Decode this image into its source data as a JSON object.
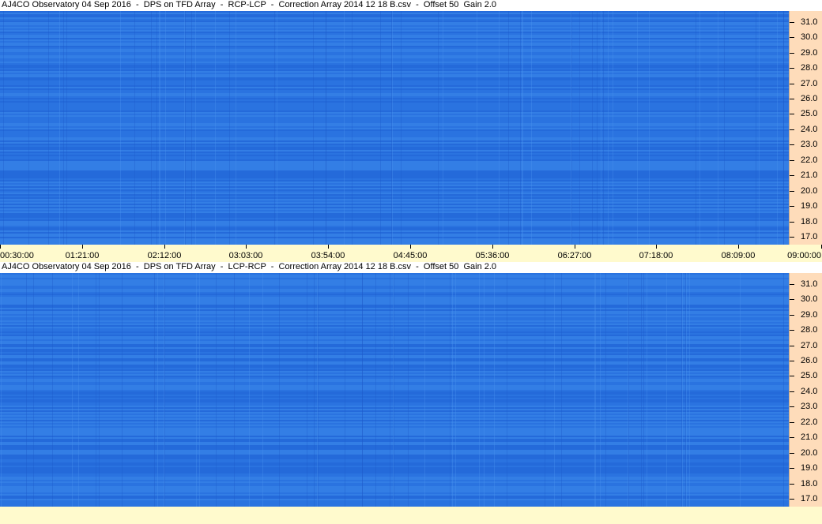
{
  "panels": [
    {
      "title": "AJ4CO Observatory 04 Sep 2016  -  DPS on TFD Array  -  RCP-LCP  -  Correction Array 2014 12 18 B.csv  -  Offset 50  Gain 2.0"
    },
    {
      "title": "AJ4CO Observatory 04 Sep 2016  -  DPS on TFD Array  -  LCP-RCP  -  Correction Array 2014 12 18 B.csv  -  Offset 50  Gain 2.0"
    }
  ],
  "chart_data": [
    {
      "type": "heatmap",
      "title": "AJ4CO Observatory 04 Sep 2016  -  DPS on TFD Array  -  RCP-LCP  -  Correction Array 2014 12 18 B.csv  -  Offset 50  Gain 2.0",
      "xlabel": "",
      "ylabel": "",
      "x_tick_labels": [
        "00:30:00",
        "01:21:00",
        "02:12:00",
        "03:03:00",
        "03:54:00",
        "04:45:00",
        "05:36:00",
        "06:27:00",
        "07:18:00",
        "08:09:00",
        "09:00:00"
      ],
      "y_tick_labels": [
        "31.0",
        "30.0",
        "29.0",
        "28.0",
        "27.0",
        "26.0",
        "25.0",
        "24.0",
        "23.0",
        "22.0",
        "21.0",
        "20.0",
        "19.0",
        "18.0",
        "17.0"
      ],
      "ylim": [
        16.5,
        31.7
      ],
      "colors": {
        "base": "#2a73e0",
        "axis_bg": "#fedcba"
      }
    },
    {
      "type": "heatmap",
      "title": "AJ4CO Observatory 04 Sep 2016  -  DPS on TFD Array  -  LCP-RCP  -  Correction Array 2014 12 18 B.csv  -  Offset 50  Gain 2.0",
      "xlabel": "",
      "ylabel": "",
      "x_tick_labels": [],
      "y_tick_labels": [
        "31.0",
        "30.0",
        "29.0",
        "28.0",
        "27.0",
        "26.0",
        "25.0",
        "24.0",
        "23.0",
        "22.0",
        "21.0",
        "20.0",
        "19.0",
        "18.0",
        "17.0"
      ],
      "ylim": [
        16.5,
        31.7
      ],
      "colors": {
        "base": "#2a73e0",
        "axis_bg": "#fedcba"
      }
    }
  ]
}
